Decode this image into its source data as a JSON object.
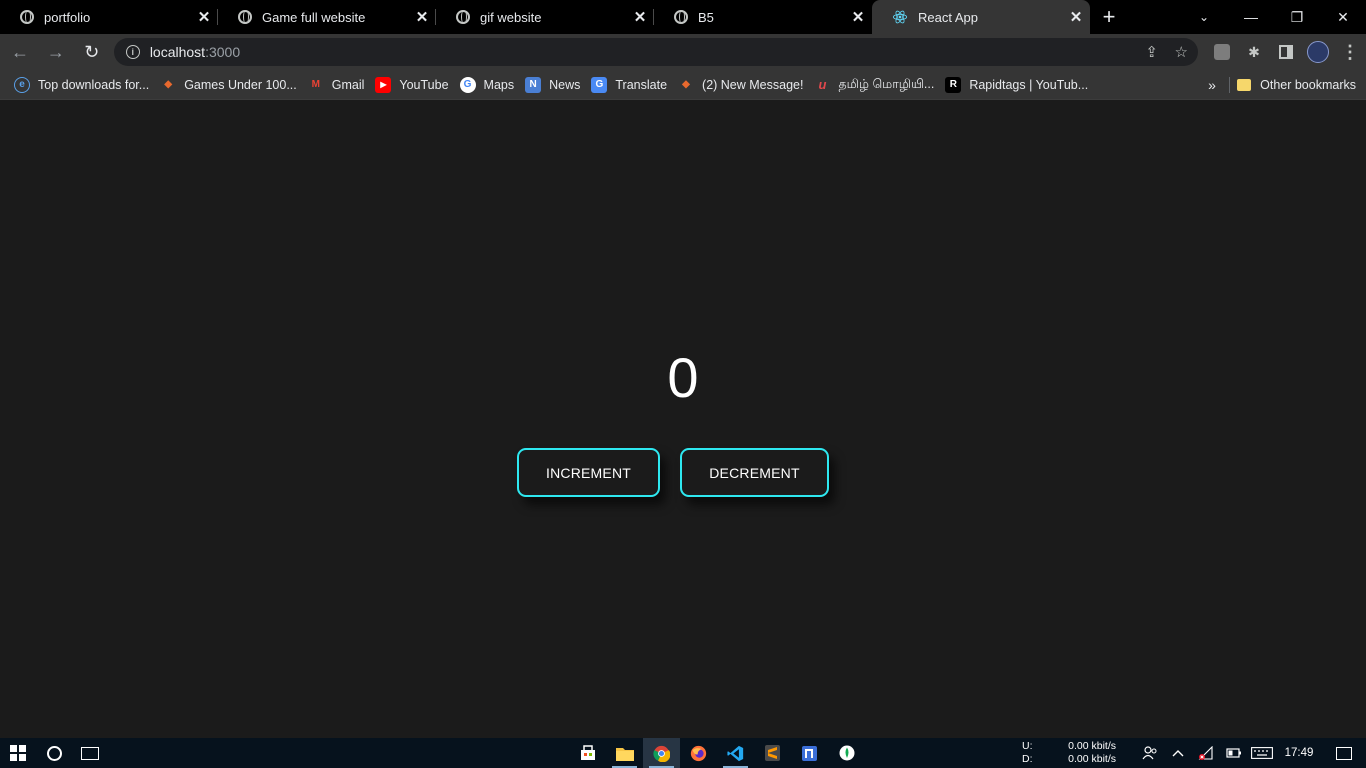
{
  "browser": {
    "tabs": [
      {
        "title": "portfolio",
        "close": "✕"
      },
      {
        "title": "Game full website",
        "close": "✕"
      },
      {
        "title": "gif website",
        "close": "✕"
      },
      {
        "title": "B5",
        "close": "✕"
      },
      {
        "title": "React App",
        "close": "✕",
        "active": true
      }
    ],
    "new_tab": "+",
    "tab_search": "⌄",
    "window_controls": {
      "minimize": "—",
      "restore": "❐",
      "close": "✕"
    },
    "nav": {
      "back": "←",
      "forward": "→",
      "reload": "↻"
    },
    "address": {
      "host": "localhost",
      "port": ":3000",
      "info_icon": "i"
    },
    "omnibox_icons": {
      "share": "⇪",
      "star": "☆"
    },
    "toolbar_icons": {
      "extensions": "✱",
      "menu": "⋮"
    },
    "bookmarks": [
      {
        "label": "Top downloads for...",
        "icon": "ie-icon",
        "color": "#3c7ad6",
        "glyph": "e"
      },
      {
        "label": "Games Under 100...",
        "icon": "firefox-icon",
        "color": "#e8692e",
        "glyph": "◆"
      },
      {
        "label": "Gmail",
        "icon": "gmail-icon",
        "color": "#ea4335",
        "glyph": "M"
      },
      {
        "label": "YouTube",
        "icon": "youtube-icon",
        "color": "#ff0000",
        "glyph": "▶"
      },
      {
        "label": "Maps",
        "icon": "google-icon",
        "color": "#ffffff",
        "glyph": "G"
      },
      {
        "label": "News",
        "icon": "news-icon",
        "color": "#4a7fd4",
        "glyph": "N"
      },
      {
        "label": "Translate",
        "icon": "translate-icon",
        "color": "#4a8af4",
        "glyph": "G"
      },
      {
        "label": "(2) New Message!",
        "icon": "message-icon",
        "color": "#e8692e",
        "glyph": "◆"
      },
      {
        "label": "தமிழ் மொழியி...",
        "icon": "tamil-icon",
        "color": "#1b1b1b",
        "glyph": "u"
      },
      {
        "label": "Rapidtags | YouTub...",
        "icon": "rapidtags-icon",
        "color": "#1b1b1b",
        "glyph": "R"
      }
    ],
    "bookmarks_more": "»",
    "other_bookmarks": "Other bookmarks"
  },
  "page": {
    "counter": "0",
    "increment_label": "INCREMENT",
    "decrement_label": "DECREMENT",
    "accent": "#2ee8f0",
    "background": "#1b1b1b"
  },
  "taskbar": {
    "apps": [
      "store-icon",
      "file-explorer-icon",
      "chrome-icon",
      "firefox-icon",
      "vscode-icon",
      "sublime-text-icon",
      "notion-icon",
      "mongodb-compass-icon"
    ],
    "network": {
      "up_label": "U:",
      "up_value": "0.00 kbit/s",
      "down_label": "D:",
      "down_value": "0.00 kbit/s"
    },
    "clock": "17:49"
  }
}
